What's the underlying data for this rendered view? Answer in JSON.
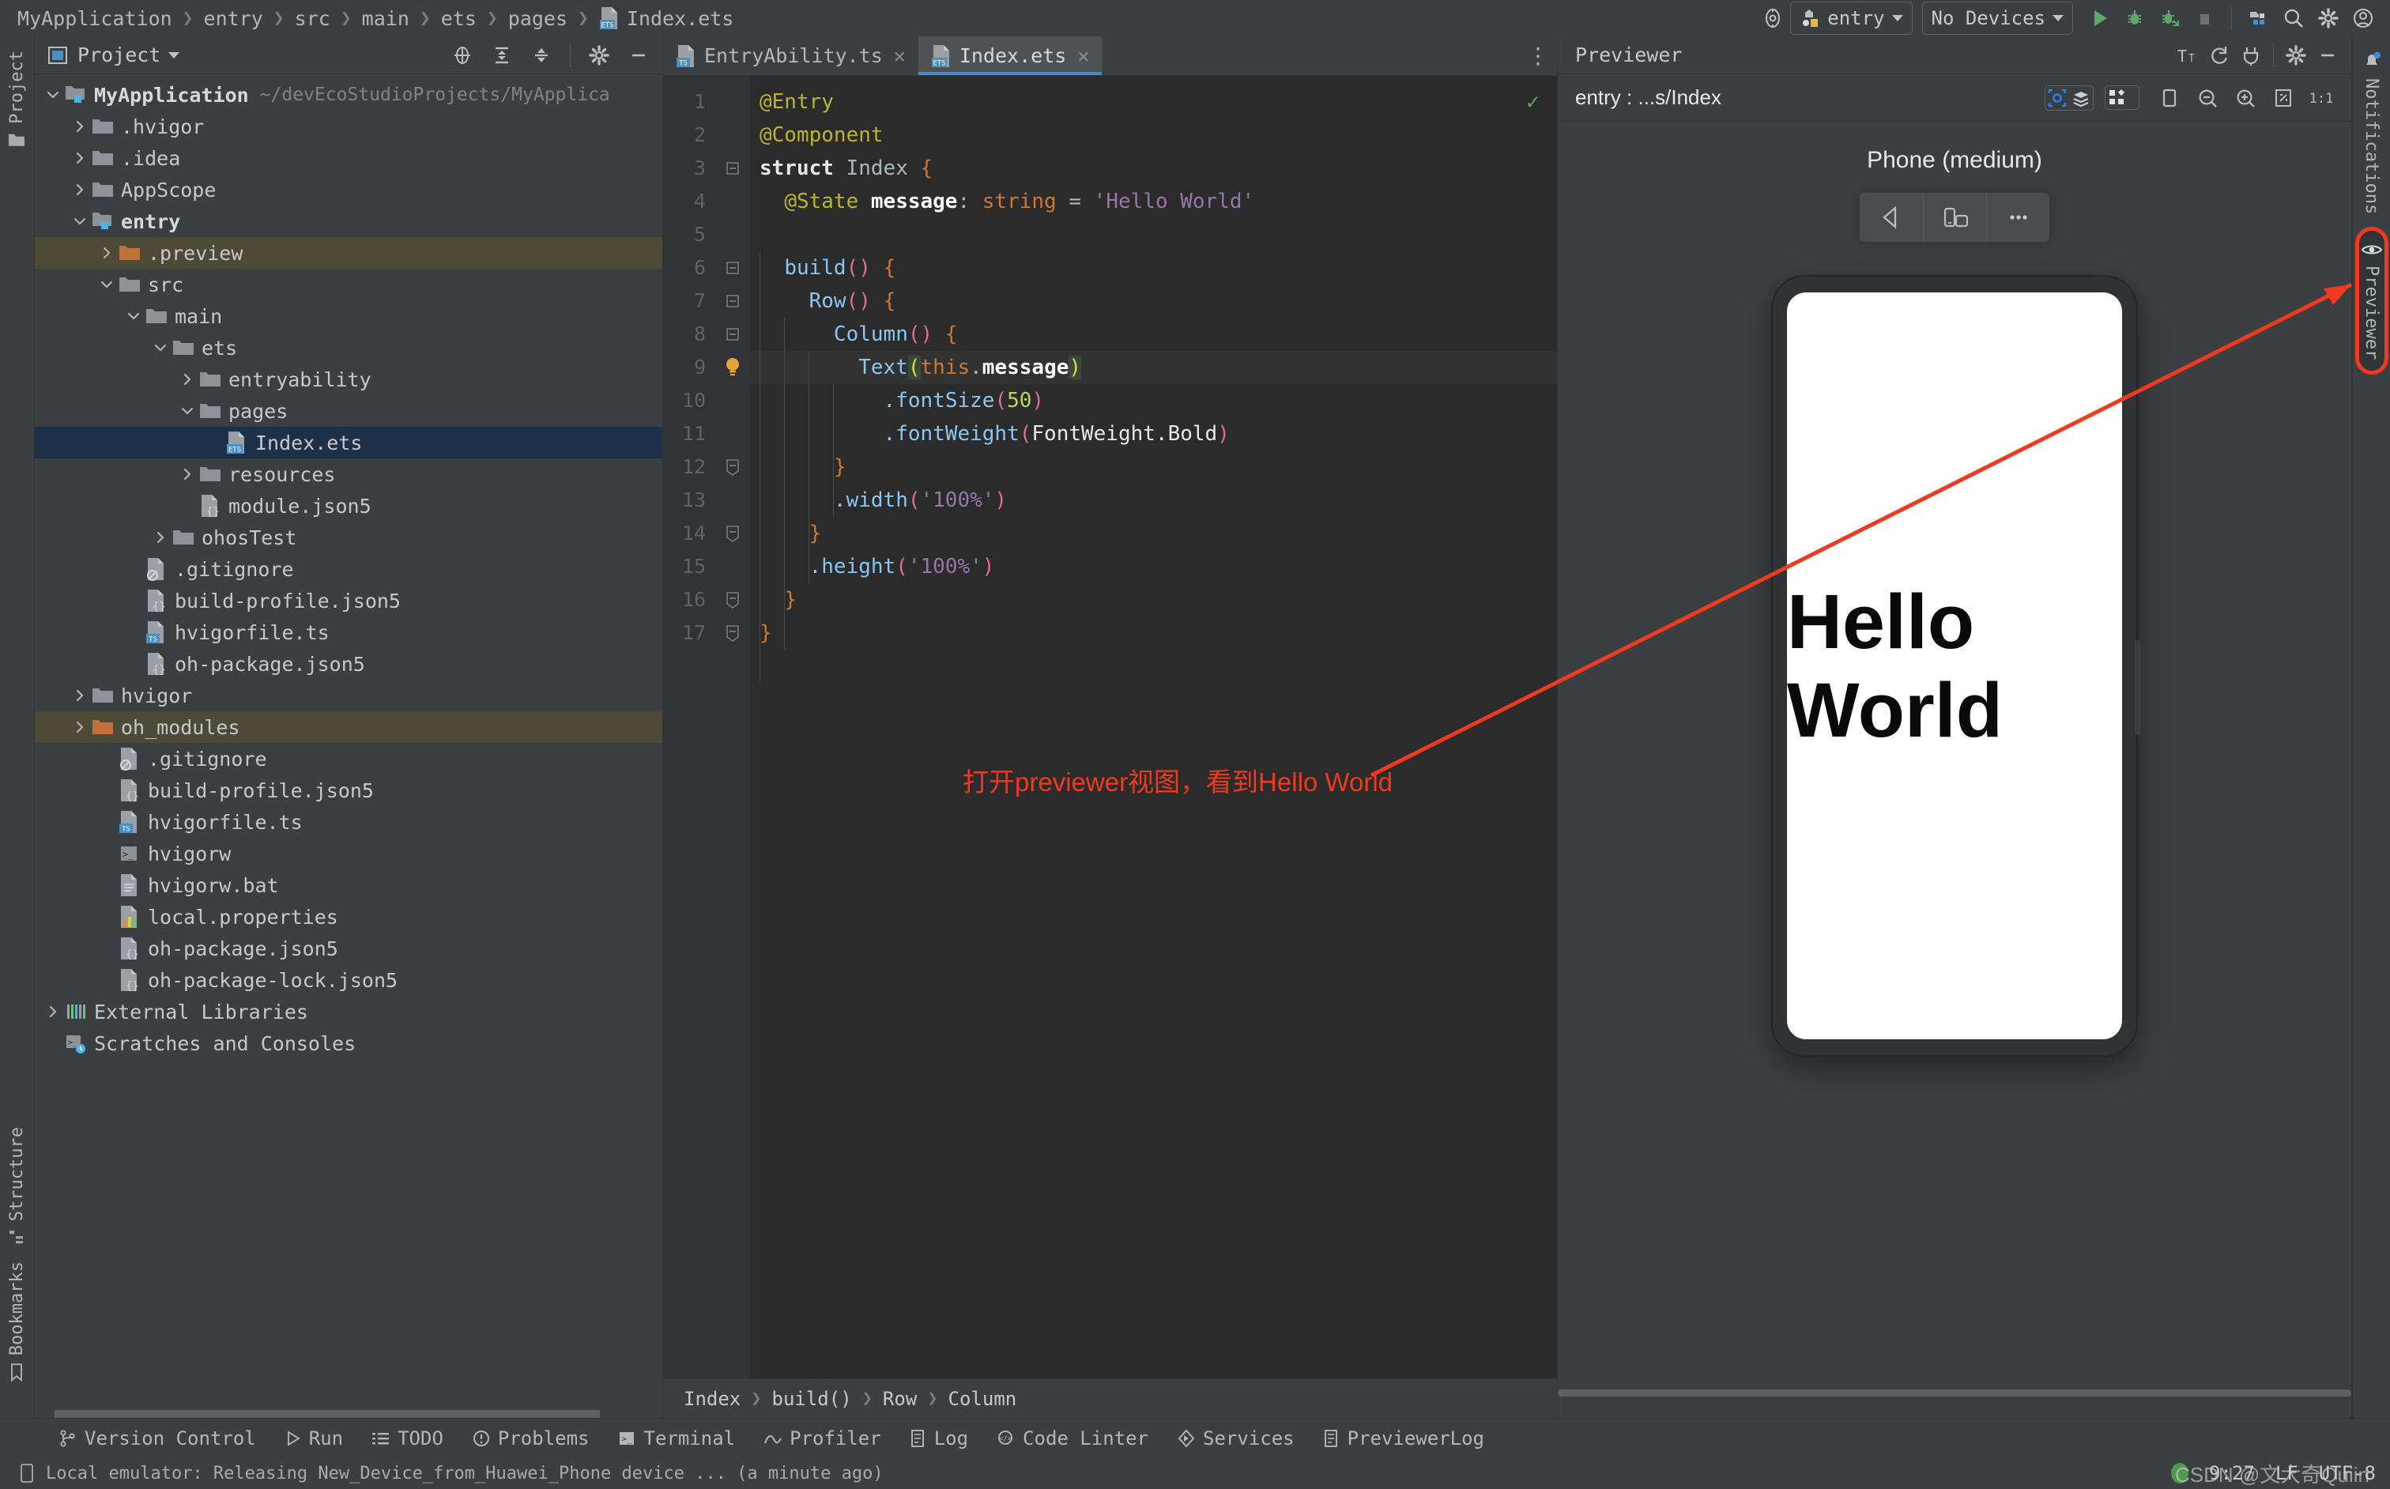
{
  "breadcrumb": {
    "items": [
      "MyApplication",
      "entry",
      "src",
      "main",
      "ets",
      "pages"
    ],
    "file": "Index.ets"
  },
  "toolbar": {
    "target_label": "entry",
    "device_label": "No Devices",
    "icons": [
      "device-manager-icon",
      "run-icon",
      "debug-icon",
      "profile-icon",
      "stop-icon",
      "project-structure-icon",
      "search-icon",
      "settings-icon",
      "account-icon"
    ]
  },
  "left_rail": {
    "items": [
      {
        "label": "Project",
        "icon": "folder-icon"
      },
      {
        "label": "Structure",
        "icon": "structure-icon"
      },
      {
        "label": "Bookmarks",
        "icon": "bookmark-icon"
      }
    ]
  },
  "right_rail": {
    "notifications_label": "Notifications",
    "previewer_label": "Previewer"
  },
  "project_panel": {
    "title": "Project",
    "header_icons": [
      "locate-icon",
      "expand-all-icon",
      "collapse-all-icon",
      "gear-icon",
      "hide-icon"
    ],
    "tree": [
      {
        "label": "MyApplication",
        "path": "~/devEcoStudioProjects/MyApplica",
        "indent": 0,
        "arrow": "down",
        "icon": "module-folder",
        "bold": true
      },
      {
        "label": ".hvigor",
        "indent": 1,
        "arrow": "right",
        "icon": "folder"
      },
      {
        "label": ".idea",
        "indent": 1,
        "arrow": "right",
        "icon": "folder"
      },
      {
        "label": "AppScope",
        "indent": 1,
        "arrow": "right",
        "icon": "folder"
      },
      {
        "label": "entry",
        "indent": 1,
        "arrow": "down",
        "icon": "module-folder",
        "bold": true
      },
      {
        "label": ".preview",
        "indent": 2,
        "arrow": "right",
        "icon": "folder-orange",
        "state": "excluded"
      },
      {
        "label": "src",
        "indent": 2,
        "arrow": "down",
        "icon": "folder"
      },
      {
        "label": "main",
        "indent": 3,
        "arrow": "down",
        "icon": "folder"
      },
      {
        "label": "ets",
        "indent": 4,
        "arrow": "down",
        "icon": "folder"
      },
      {
        "label": "entryability",
        "indent": 5,
        "arrow": "right",
        "icon": "folder"
      },
      {
        "label": "pages",
        "indent": 5,
        "arrow": "down",
        "icon": "folder"
      },
      {
        "label": "Index.ets",
        "indent": 6,
        "arrow": "none",
        "icon": "ets-file",
        "state": "selected"
      },
      {
        "label": "resources",
        "indent": 5,
        "arrow": "right",
        "icon": "folder"
      },
      {
        "label": "module.json5",
        "indent": 5,
        "arrow": "none",
        "icon": "json-file"
      },
      {
        "label": "ohosTest",
        "indent": 4,
        "arrow": "right",
        "icon": "folder"
      },
      {
        "label": ".gitignore",
        "indent": 3,
        "arrow": "none",
        "icon": "gitignore-file"
      },
      {
        "label": "build-profile.json5",
        "indent": 3,
        "arrow": "none",
        "icon": "json-file"
      },
      {
        "label": "hvigorfile.ts",
        "indent": 3,
        "arrow": "none",
        "icon": "ts-file"
      },
      {
        "label": "oh-package.json5",
        "indent": 3,
        "arrow": "none",
        "icon": "json-file"
      },
      {
        "label": "hvigor",
        "indent": 1,
        "arrow": "right",
        "icon": "folder"
      },
      {
        "label": "oh_modules",
        "indent": 1,
        "arrow": "right",
        "icon": "folder-orange",
        "state": "excluded"
      },
      {
        "label": ".gitignore",
        "indent": 2,
        "arrow": "none",
        "icon": "gitignore-file"
      },
      {
        "label": "build-profile.json5",
        "indent": 2,
        "arrow": "none",
        "icon": "json-file"
      },
      {
        "label": "hvigorfile.ts",
        "indent": 2,
        "arrow": "none",
        "icon": "ts-file"
      },
      {
        "label": "hvigorw",
        "indent": 2,
        "arrow": "none",
        "icon": "script-file"
      },
      {
        "label": "hvigorw.bat",
        "indent": 2,
        "arrow": "none",
        "icon": "text-file"
      },
      {
        "label": "local.properties",
        "indent": 2,
        "arrow": "none",
        "icon": "properties-file"
      },
      {
        "label": "oh-package.json5",
        "indent": 2,
        "arrow": "none",
        "icon": "json-file"
      },
      {
        "label": "oh-package-lock.json5",
        "indent": 2,
        "arrow": "none",
        "icon": "json-file"
      },
      {
        "label": "External Libraries",
        "indent": 0,
        "arrow": "right",
        "icon": "library-icon"
      },
      {
        "label": "Scratches and Consoles",
        "indent": 0,
        "arrow": "none",
        "icon": "scratches-icon"
      }
    ]
  },
  "editor": {
    "tabs": [
      {
        "label": "EntryAbility.ts",
        "icon": "ts-file",
        "active": false
      },
      {
        "label": "Index.ets",
        "icon": "ets-file",
        "active": true
      }
    ],
    "line_count": 17,
    "lines": [
      "@Entry",
      "@Component",
      "struct Index {",
      "  @State message: string = 'Hello World'",
      "",
      "  build() {",
      "    Row() {",
      "      Column() {",
      "        Text(this.message)",
      "          .fontSize(50)",
      "          .fontWeight(FontWeight.Bold)",
      "      }",
      "      .width('100%')",
      "    }",
      "    .height('100%')",
      "  }",
      "}"
    ],
    "highlight_line": 9,
    "breadcrumb": [
      "Index",
      "build()",
      "Row",
      "Column"
    ]
  },
  "previewer": {
    "title": "Previewer",
    "header_icons": [
      "font-size-icon",
      "refresh-icon",
      "plugin-icon",
      "gear-icon",
      "hide-icon"
    ],
    "path": "entry : ...s/Index",
    "toolbar_icons": [
      "inspector-icon",
      "layers-icon",
      "multi-device-icon",
      "chevron-down-icon",
      "rotate-icon",
      "zoom-out-icon",
      "zoom-in-icon",
      "fit-screen-icon",
      "actual-size-icon"
    ],
    "device_name": "Phone (medium)",
    "device_controls": [
      "back-icon",
      "rotate-device-icon",
      "more-icon"
    ],
    "screen_text": "Hello World"
  },
  "annotation": {
    "text": "打开previewer视图，看到Hello World",
    "color": "#f03a20"
  },
  "bottom_tools": [
    {
      "label": "Version Control",
      "icon": "branch-icon"
    },
    {
      "label": "Run",
      "icon": "run-icon"
    },
    {
      "label": "TODO",
      "icon": "todo-icon"
    },
    {
      "label": "Problems",
      "icon": "problems-icon"
    },
    {
      "label": "Terminal",
      "icon": "terminal-icon"
    },
    {
      "label": "Profiler",
      "icon": "profiler-icon"
    },
    {
      "label": "Log",
      "icon": "log-icon"
    },
    {
      "label": "Code Linter",
      "icon": "linter-icon"
    },
    {
      "label": "Services",
      "icon": "services-icon"
    },
    {
      "label": "PreviewerLog",
      "icon": "previewerlog-icon"
    }
  ],
  "status_bar": {
    "message": "Local emulator: Releasing New_Device_from_Huawei_Phone device ... (a minute ago)",
    "time": "9:27",
    "line_ending": "LF",
    "encoding": "UTF-8",
    "watermark": "CSDN @文大奇Quiin"
  },
  "colors": {
    "accent_blue": "#4a88c7",
    "annotation_red": "#f03a20",
    "excluded_orange": "#c2703a",
    "selection_blue": "#1c3048"
  }
}
